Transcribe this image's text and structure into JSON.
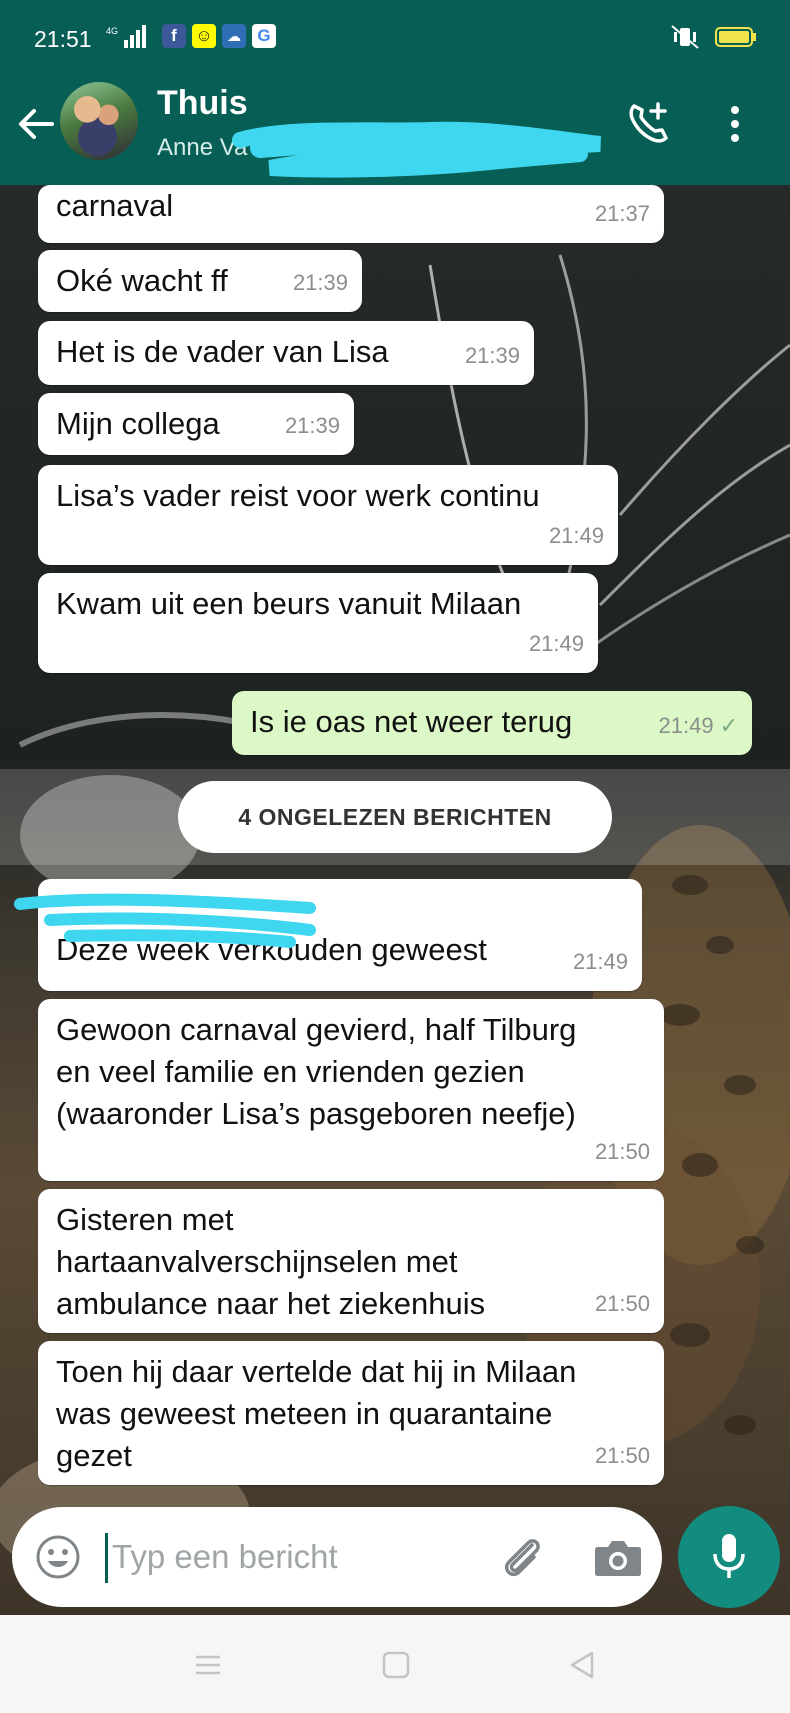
{
  "status_bar": {
    "time": "21:51",
    "network": "4G",
    "apps": [
      "facebook-icon",
      "snapchat-icon",
      "weather-icon",
      "google-icon"
    ]
  },
  "header": {
    "contact_name": "Thuis",
    "subtitle": "Anne Va",
    "icons": [
      "back-arrow-icon",
      "add-call-icon",
      "more-vert-icon"
    ]
  },
  "messages": [
    {
      "text": "carnaval",
      "time": "21:37",
      "dir": "in"
    },
    {
      "text": "Oké wacht ff",
      "time": "21:39",
      "dir": "in"
    },
    {
      "text": "Het is de vader van Lisa",
      "time": "21:39",
      "dir": "in"
    },
    {
      "text": "Mijn collega",
      "time": "21:39",
      "dir": "in"
    },
    {
      "text": "Lisa’s vader reist voor werk continu",
      "time": "21:49",
      "dir": "in"
    },
    {
      "text": "Kwam uit een beurs vanuit Milaan",
      "time": "21:49",
      "dir": "in"
    },
    {
      "text": "Is ie oas net weer terug",
      "time": "21:49",
      "dir": "out",
      "status": "✓"
    },
    {
      "text": "Deze week verkouden geweest",
      "time": "21:49",
      "dir": "in"
    },
    {
      "text": "Gewoon carnaval gevierd, half Tilburg\nen veel familie en vrienden gezien\n(waaronder Lisa’s pasgeboren neefje)",
      "time": "21:50",
      "dir": "in"
    },
    {
      "text": "Gisteren met\nhartaanvalverschijnselen met\nambulance naar het ziekenhuis",
      "time": "21:50",
      "dir": "in"
    },
    {
      "text": "Toen hij daar vertelde dat hij in Milaan\nwas geweest meteen in quarantaine\ngezet",
      "time": "21:50",
      "dir": "in"
    }
  ],
  "unread_banner": "4 ONGELEZEN BERICHTEN",
  "composer": {
    "placeholder": "Typ een bericht",
    "icons": [
      "emoji-icon",
      "attach-icon",
      "camera-icon",
      "mic-icon"
    ]
  },
  "colors": {
    "header": "#075e54",
    "outgoing_bubble": "#dcf8c6",
    "incoming_bubble": "#ffffff",
    "mic_button": "#128c7e",
    "redaction": "#3fd6f0"
  }
}
